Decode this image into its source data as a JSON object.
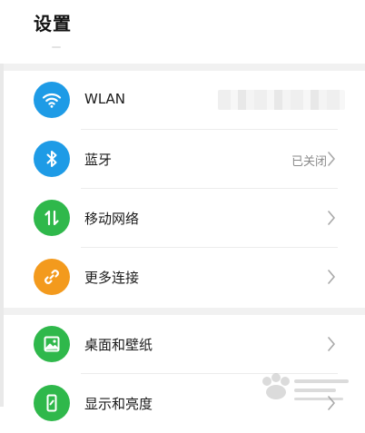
{
  "header": {
    "title": "设置"
  },
  "rows": [
    {
      "label": "WLAN",
      "value": "",
      "icon": "wifi-icon",
      "color": "#1e9be6"
    },
    {
      "label": "蓝牙",
      "value": "已关闭",
      "icon": "bluetooth-icon",
      "color": "#1e9be6"
    },
    {
      "label": "移动网络",
      "value": "",
      "icon": "mobile-network-icon",
      "color": "#2fb84b"
    },
    {
      "label": "更多连接",
      "value": "",
      "icon": "link-icon",
      "color": "#f39a1d"
    },
    {
      "label": "桌面和壁纸",
      "value": "",
      "icon": "wallpaper-icon",
      "color": "#2fb84b"
    },
    {
      "label": "显示和亮度",
      "value": "",
      "icon": "display-icon",
      "color": "#2fb84b"
    }
  ]
}
